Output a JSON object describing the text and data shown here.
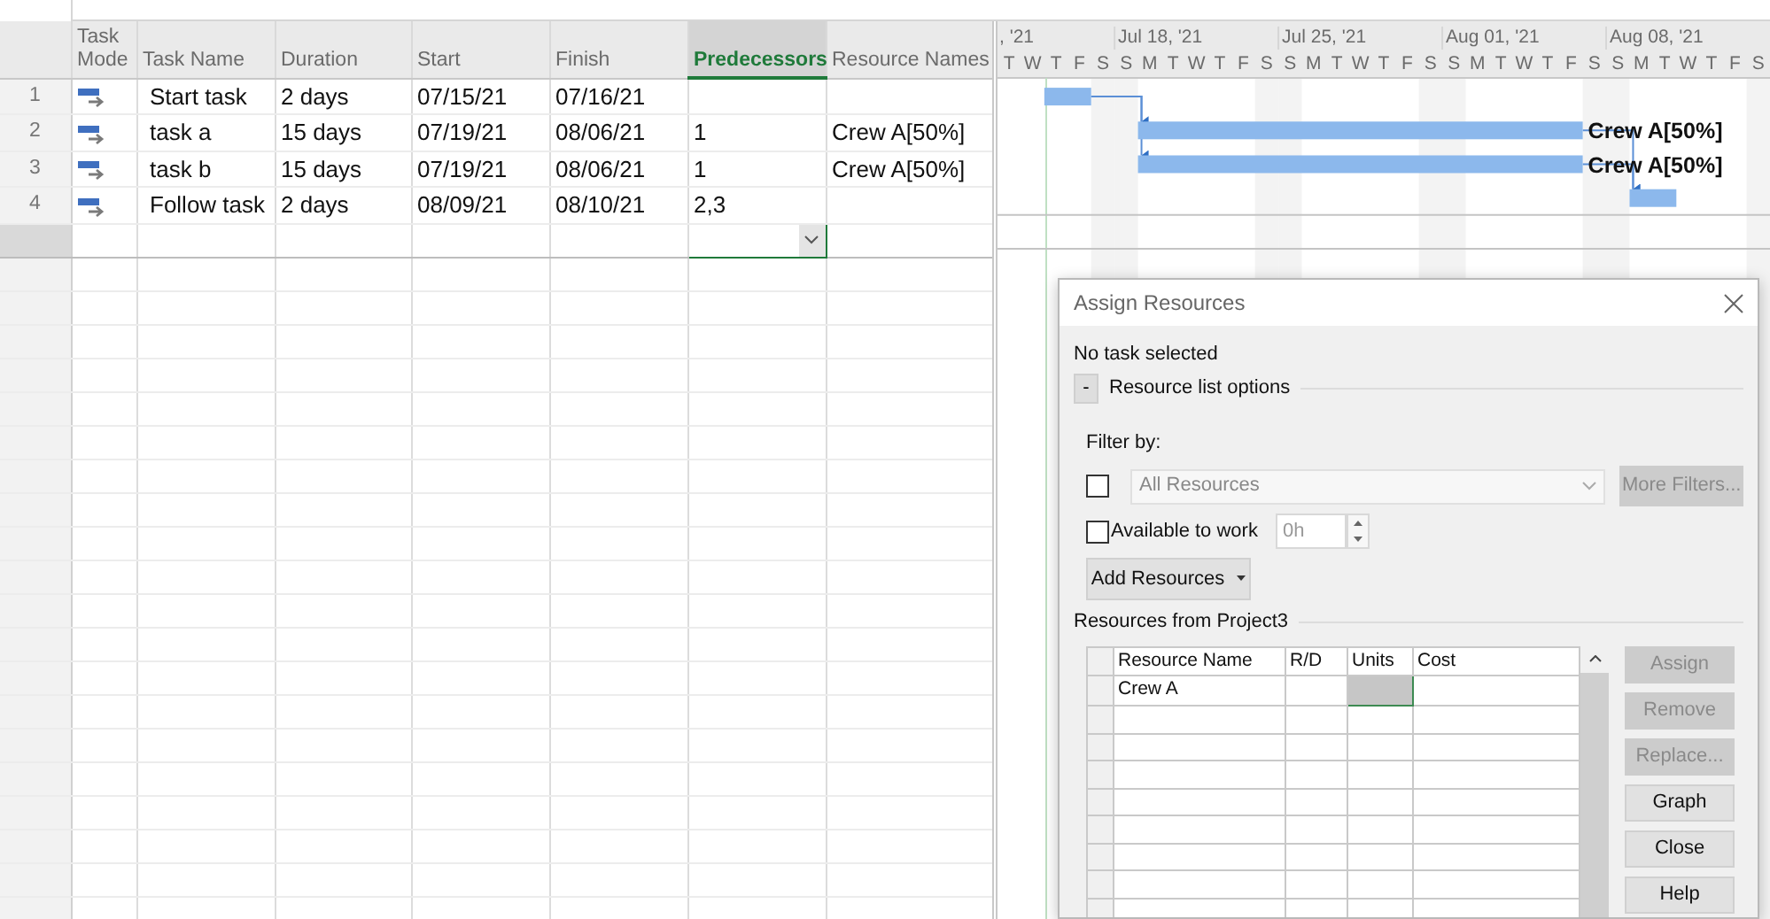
{
  "table": {
    "columns": [
      {
        "label": "Task Mode",
        "selected": false
      },
      {
        "label": "Task Name",
        "selected": false
      },
      {
        "label": "Duration",
        "selected": false
      },
      {
        "label": "Start",
        "selected": false
      },
      {
        "label": "Finish",
        "selected": false
      },
      {
        "label": "Predecessors",
        "selected": true
      },
      {
        "label": "Resource Names",
        "selected": false
      }
    ],
    "rows": [
      {
        "number": "1",
        "kind": "auto",
        "task_name": "Start task",
        "duration": "2 days",
        "start": "07/15/21",
        "finish": "07/16/21"
      },
      {
        "number": "2",
        "kind": "auto",
        "task_name": "task a",
        "duration": "15 days",
        "start": "07/19/21",
        "finish": "08/06/21",
        "predecessors": "1",
        "resource_names": "Crew A[50%]",
        "bar_label": "Crew A[50%]"
      },
      {
        "number": "3",
        "kind": "auto",
        "task_name": "task b",
        "duration": "15 days",
        "start": "07/19/21",
        "finish": "08/06/21",
        "predecessors": "1",
        "resource_names": "Crew A[50%]",
        "bar_label": "Crew A[50%]"
      },
      {
        "number": "4",
        "kind": "auto",
        "task_name": "Follow task",
        "duration": "2 days",
        "start": "08/09/21",
        "finish": "08/10/21",
        "predecessors": "2,3"
      }
    ]
  },
  "gantt": {
    "weeks": [
      ", '21",
      "Jul 18, '21",
      "Jul 25, '21",
      "Aug 01, '21",
      "Aug 08, '21"
    ],
    "days": [
      "T",
      "W",
      "T",
      "F",
      "S",
      "S",
      "M",
      "T",
      "W",
      "T",
      "F",
      "S",
      "S",
      "M",
      "T",
      "W",
      "T",
      "F",
      "S",
      "S",
      "M",
      "T",
      "W",
      "T",
      "F",
      "S",
      "S",
      "M",
      "T",
      "W",
      "T",
      "F",
      "S"
    ]
  },
  "dialog": {
    "title": "Assign Resources",
    "status": "No task selected",
    "options_toggle": "-",
    "options_label": "Resource list options",
    "filter_label": "Filter by:",
    "filter_checkbox": {
      "checked": false
    },
    "filter_select": {
      "value": "All Resources",
      "disabled": true
    },
    "more_filters": {
      "label": "More Filters...",
      "disabled": true
    },
    "available": {
      "label": "Available to work",
      "checked": false
    },
    "hours": {
      "value": "0h",
      "disabled": true
    },
    "add_button": "Add Resources",
    "resources_label": "Resources from Project3",
    "resource_columns": [
      "Resource Name",
      "R/D",
      "Units",
      "Cost"
    ],
    "resources": [
      {
        "name": "Crew A",
        "units_selected": true
      }
    ],
    "buttons": [
      {
        "label": "Assign",
        "disabled": true
      },
      {
        "label": "Remove",
        "disabled": true
      },
      {
        "label": "Replace...",
        "disabled": true
      },
      {
        "label": "Graph",
        "disabled": false
      },
      {
        "label": "Close",
        "disabled": false
      },
      {
        "label": "Help",
        "disabled": false
      }
    ]
  }
}
